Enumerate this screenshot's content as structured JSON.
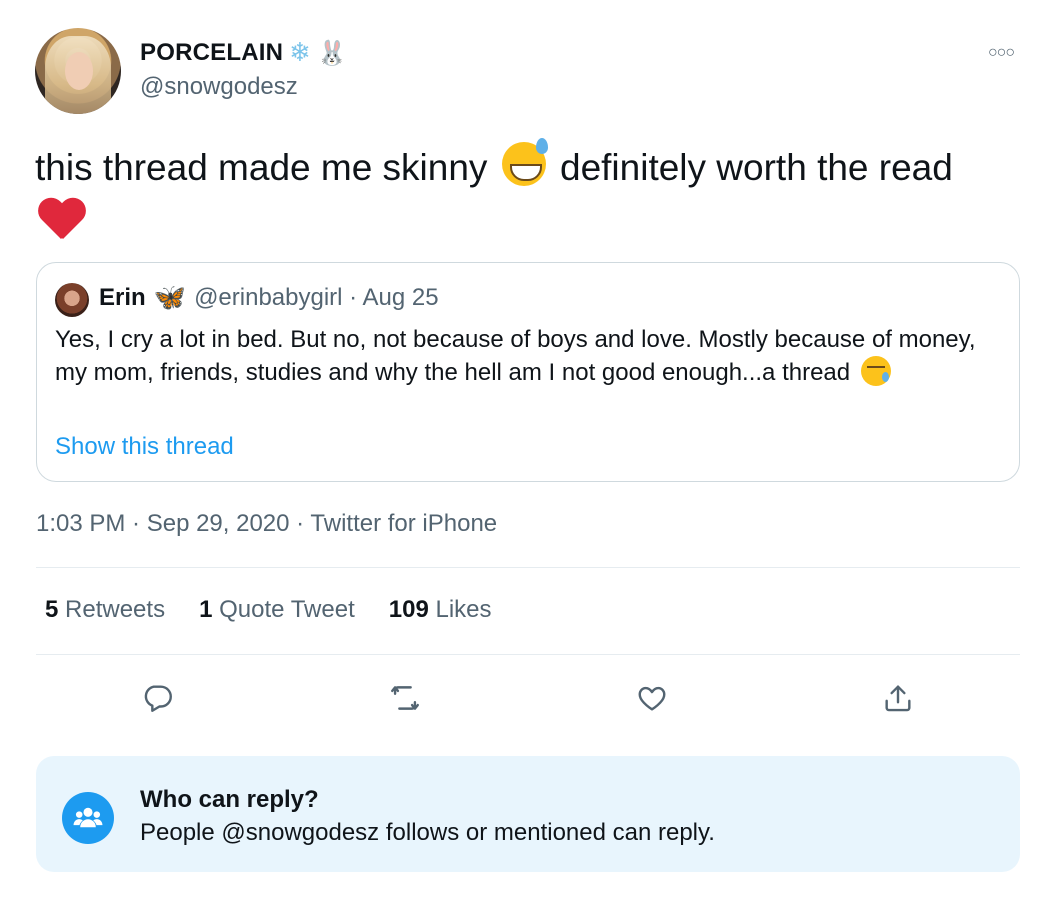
{
  "author": {
    "display_name": "PORCELAIN",
    "name_emoji_1": "❄",
    "name_emoji_2": "🐰",
    "handle": "@snowgodesz"
  },
  "tweet": {
    "text_part1": "this thread made me skinny",
    "text_emoji_1": "grinning-sweat-emoji",
    "text_part2": "definitely worth the read",
    "text_emoji_2": "red-heart-emoji"
  },
  "quote": {
    "name": "Erin",
    "name_emoji": "🦋",
    "meta": "@erinbabygirl · Aug 25",
    "text": "Yes, I cry a lot in bed. But no, not because of boys and love. Mostly because of money, my mom, friends, studies and why the hell am I not good enough...a thread",
    "text_emoji": "sad-tear-emoji",
    "show_thread_label": "Show this thread"
  },
  "timestamp": "1:03 PM · Sep 29, 2020 · Twitter for iPhone",
  "stats": {
    "retweets_count": "5",
    "retweets_label": "Retweets",
    "quotes_count": "1",
    "quotes_label": "Quote Tweet",
    "likes_count": "109",
    "likes_label": "Likes"
  },
  "actions": [
    "reply-icon",
    "retweet-icon",
    "like-icon",
    "share-icon"
  ],
  "reply_restriction": {
    "title": "Who can reply?",
    "description": "People @snowgodesz follows or mentioned can reply."
  },
  "colors": {
    "accent": "#1d9bf0",
    "secondary_text": "#536471",
    "reply_box_bg": "#e8f5fd",
    "heart": "#e0283c"
  }
}
